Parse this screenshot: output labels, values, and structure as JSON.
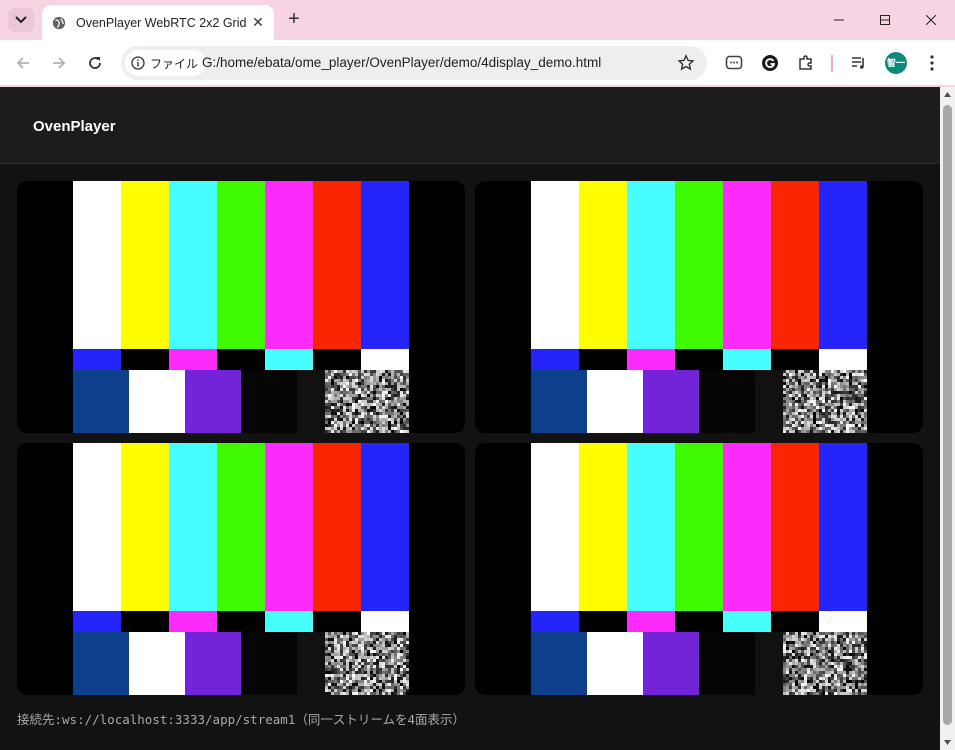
{
  "browser": {
    "tab_title": "OvenPlayer WebRTC 2x2 Grid",
    "new_tab": "+",
    "close_tab": "✕",
    "security_chip": "ファイル",
    "url": "G:/home/ebata/ome_player/OvenPlayer/demo/4display_demo.html",
    "profile_initials": "智一"
  },
  "page": {
    "brand": "OvenPlayer",
    "status": "接続先:ws://localhost:3333/app/stream1（同一ストリームを4面表示）",
    "players": [
      "player-1",
      "player-2",
      "player-3",
      "player-4"
    ]
  },
  "colors": {
    "tab_strip": "#f6d4e3",
    "page_bg": "#121212",
    "header_bg": "#1c1c1c",
    "bars_top": [
      "#ffffff",
      "#fffd00",
      "#46fefe",
      "#3ffa00",
      "#fc2bfb",
      "#f92400",
      "#2424fb"
    ],
    "bars_mid": [
      "#2424fb",
      "#000000",
      "#fc2bfb",
      "#000000",
      "#46fefe",
      "#000000",
      "#ffffff"
    ],
    "bars_bottom": [
      "#0e3f8c",
      "#ffffff",
      "#7424d8",
      "#050505",
      "#111111"
    ]
  }
}
